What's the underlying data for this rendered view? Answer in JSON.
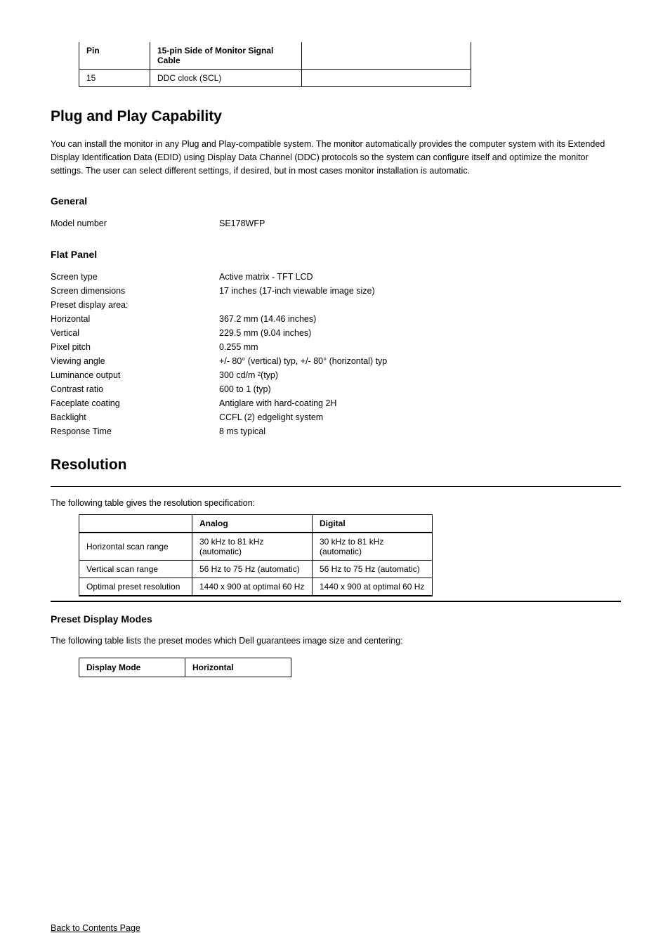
{
  "table1": {
    "header": [
      "Pin",
      "15-pin Side of Monitor Signal Cable",
      ""
    ],
    "row": [
      "15",
      "DDC clock (SCL)",
      ""
    ]
  },
  "sections": {
    "plug_and_play": {
      "title": "Plug and Play Capability",
      "body": "You can install the monitor in any Plug and Play-compatible system. The monitor automatically provides the computer system with its Extended Display Identification Data (EDID) using Display Data Channel (DDC) protocols so the system can configure itself and optimize the monitor settings. The user can select different settings, if desired, but in most cases monitor installation is automatic."
    },
    "general": {
      "title": "General",
      "lines": [
        [
          "Model number",
          "SE178WFP"
        ]
      ]
    },
    "flat_panel": {
      "title": "Flat Panel",
      "lines": [
        [
          "Screen type",
          "Active matrix - TFT LCD"
        ],
        [
          "Screen dimensions",
          "17 inches (17-inch viewable image size)"
        ],
        [
          "Preset display area:",
          ""
        ],
        [
          "Horizontal",
          "367.2 mm (14.46 inches)"
        ],
        [
          "Vertical",
          "229.5 mm (9.04 inches)"
        ],
        [
          "Pixel pitch",
          "0.255 mm"
        ],
        [
          "Viewing angle",
          "+/- 80° (vertical) typ, +/- 80° (horizontal) typ"
        ],
        [
          "Luminance output",
          "300 cd/m ²(typ)"
        ],
        [
          "Contrast ratio",
          "600 to 1 (typ)"
        ],
        [
          "Faceplate coating",
          "Antiglare with hard-coating 2H"
        ],
        [
          "Backlight",
          "CCFL (2) edgelight system"
        ],
        [
          "Response Time",
          "8 ms typical"
        ]
      ]
    }
  },
  "resolution": {
    "title": "Resolution",
    "caption": "The following table gives the resolution specification:",
    "table": {
      "header": [
        "",
        "Analog",
        "Digital"
      ],
      "rows": [
        [
          "Horizontal scan range",
          "30 kHz to 81 kHz (automatic)",
          "30 kHz to 81 kHz (automatic)"
        ],
        [
          "Vertical scan range",
          "56 Hz to 75 Hz (automatic)",
          "56 Hz to 75 Hz (automatic)"
        ],
        [
          "Optimal preset resolution",
          "1440 x 900 at optimal 60 Hz",
          "1440 x 900 at optimal 60 Hz"
        ]
      ]
    }
  },
  "preset": {
    "title": "Preset Display Modes",
    "caption": "The following table lists the preset modes which Dell guarantees image size and centering:",
    "table": {
      "header": [
        "Display Mode",
        "Horizontal"
      ]
    }
  },
  "back": "Back to Contents Page"
}
